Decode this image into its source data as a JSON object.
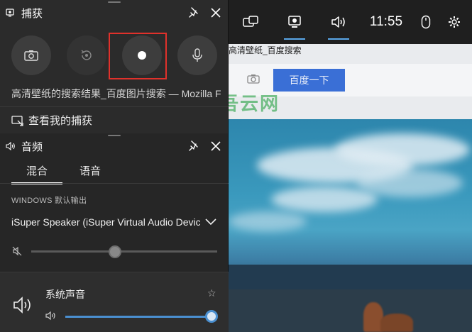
{
  "background": {
    "tab_text": "高清壁纸_百度搜索",
    "search_button": "百度一下",
    "watermark": "吾云网"
  },
  "topbar": {
    "time": "11:55",
    "icons": [
      "widget-icon",
      "capture-icon",
      "audio-icon",
      "mouse-icon",
      "settings-icon"
    ],
    "active": [
      "capture-icon",
      "audio-icon"
    ]
  },
  "capture": {
    "title": "捕获",
    "buttons": [
      "screenshot",
      "record-last",
      "record",
      "microphone"
    ],
    "window_title": "高清壁纸的搜索结果_百度图片搜索 — Mozilla Firefox",
    "show_captures": "查看我的捕获"
  },
  "audio": {
    "title": "音频",
    "tabs": [
      "混合",
      "语音"
    ],
    "active_tab": "混合",
    "section_label": "WINDOWS 默认输出",
    "device": "iSuper Speaker (iSuper Virtual Audio Device)",
    "master_volume": 0.45,
    "app": {
      "name": "系统声音",
      "volume": 1.0
    }
  },
  "colors": {
    "accent": "#4a8fd0",
    "highlight_box": "#e0312b",
    "panel_bg": "#2b2b2b"
  }
}
